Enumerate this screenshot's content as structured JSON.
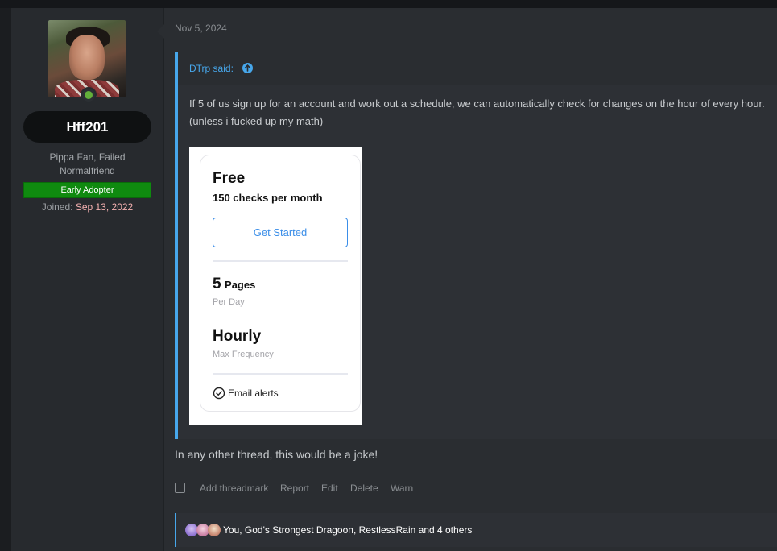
{
  "post": {
    "date": "Nov 5, 2024",
    "reply_text": "In any other thread, this would be a joke!"
  },
  "user": {
    "name": "Hff201",
    "title_line1": "Pippa Fan, Failed",
    "title_line2": "Normalfriend",
    "banner": "Early Adopter",
    "joined_label": "Joined:",
    "joined_date": "Sep 13, 2022",
    "status_color": "#63b03a"
  },
  "quote": {
    "author": "DTrp said:",
    "line1": "If 5 of us sign up for an account and work out a schedule, we can automatically check for changes on the hour of every hour.",
    "line2": "(unless i fucked up my math)",
    "accent_color": "#47a7eb"
  },
  "pricing_card": {
    "plan": "Free",
    "checks": "150 checks per month",
    "button": "Get Started",
    "pages_num": "5",
    "pages_unit": "Pages",
    "per_day": "Per Day",
    "hourly": "Hourly",
    "max_frequency": "Max Frequency",
    "alerts": "Email alerts"
  },
  "actions": {
    "bookmark": "Add threadmark",
    "report": "Report",
    "edit": "Edit",
    "delete": "Delete",
    "warn": "Warn"
  },
  "reactions": {
    "text": "You, God's Strongest Dragoon, RestlessRain and 4 others"
  }
}
